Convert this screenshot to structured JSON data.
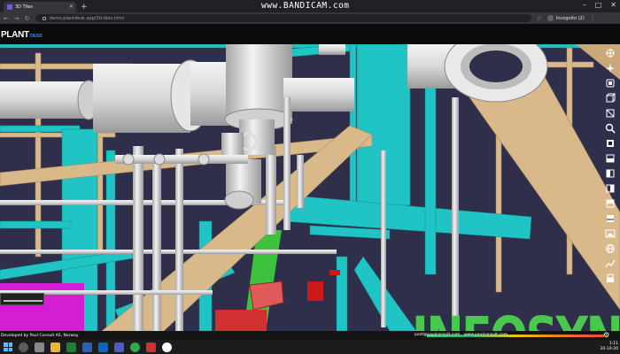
{
  "browser": {
    "tab_title": "3D Tiles",
    "url": "demo.plantdesk.app/3d-tiles.html",
    "profile": "Incognito (2)",
    "watermark": "www.BANDICAM.com"
  },
  "app": {
    "logo_main": "PLANT",
    "logo_sub": "DESK"
  },
  "viewport": {
    "overlay_text": "INFOSYNC"
  },
  "toolbar_icons": [
    "compass-icon",
    "airplane-icon",
    "home-view-icon",
    "cube-icon",
    "box-icon",
    "search-icon",
    "view-front-icon",
    "view-back-icon",
    "view-left-icon",
    "view-right-icon",
    "view-top-icon",
    "view-bottom-icon",
    "image-icon",
    "globe-icon",
    "measure-icon",
    "print-icon"
  ],
  "status": {
    "developer": "Developed by Paul Consult AS, Norway",
    "email": "post@paulconsult.com",
    "website": "www.paulconsult.com"
  },
  "taskbar": {
    "time": "1:11",
    "date": "20-10-20"
  },
  "colors": {
    "steel_teal": "#20c4c4",
    "pipe_grey": "#d8d8d8",
    "beam_tan": "#d9b98a",
    "sky_purple": "#2f2f4c",
    "valve_red": "#d23030",
    "magenta": "#d41ed4",
    "green": "#3cc23c",
    "logo_green": "#49c84d"
  }
}
